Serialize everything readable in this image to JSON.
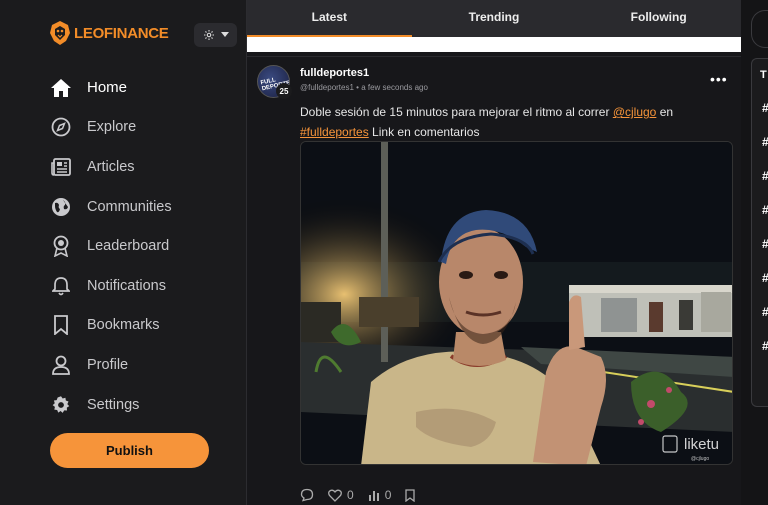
{
  "brand": {
    "name": "LEOFINANCE"
  },
  "sidebar": {
    "items": [
      {
        "label": "Home",
        "icon": "home-icon"
      },
      {
        "label": "Explore",
        "icon": "compass-icon"
      },
      {
        "label": "Articles",
        "icon": "newspaper-icon"
      },
      {
        "label": "Communities",
        "icon": "globe-icon"
      },
      {
        "label": "Leaderboard",
        "icon": "award-icon"
      },
      {
        "label": "Notifications",
        "icon": "bell-icon"
      },
      {
        "label": "Bookmarks",
        "icon": "bookmark-icon"
      },
      {
        "label": "Profile",
        "icon": "user-icon"
      },
      {
        "label": "Settings",
        "icon": "gear-icon"
      }
    ],
    "publish_label": "Publish"
  },
  "tabs": [
    {
      "label": "Latest",
      "active": true
    },
    {
      "label": "Trending",
      "active": false
    },
    {
      "label": "Following",
      "active": false
    }
  ],
  "post": {
    "author": "fulldeportes1",
    "handle": "@fulldeportes1",
    "time": "a few seconds ago",
    "reputation": "25",
    "avatar_text": "FULL DEPORTES",
    "text_1": "Doble sesión de 15 minutos para mejorar el ritmo al correr ",
    "mention": "@cjlugo",
    "text_2": " en",
    "hashtag": "#fulldeportes",
    "text_3": " Link en comentarios",
    "watermark": "liketu",
    "watermark_sub": "@cjlugo",
    "likes": "0",
    "views": "0"
  },
  "right_panel": {
    "title": "T",
    "hash_symbol": "#"
  },
  "colors": {
    "accent": "#f28c28",
    "publish": "#f6943a",
    "sidebar_bg": "#1b1b1d",
    "tabs_bg": "#2a2a2e"
  }
}
